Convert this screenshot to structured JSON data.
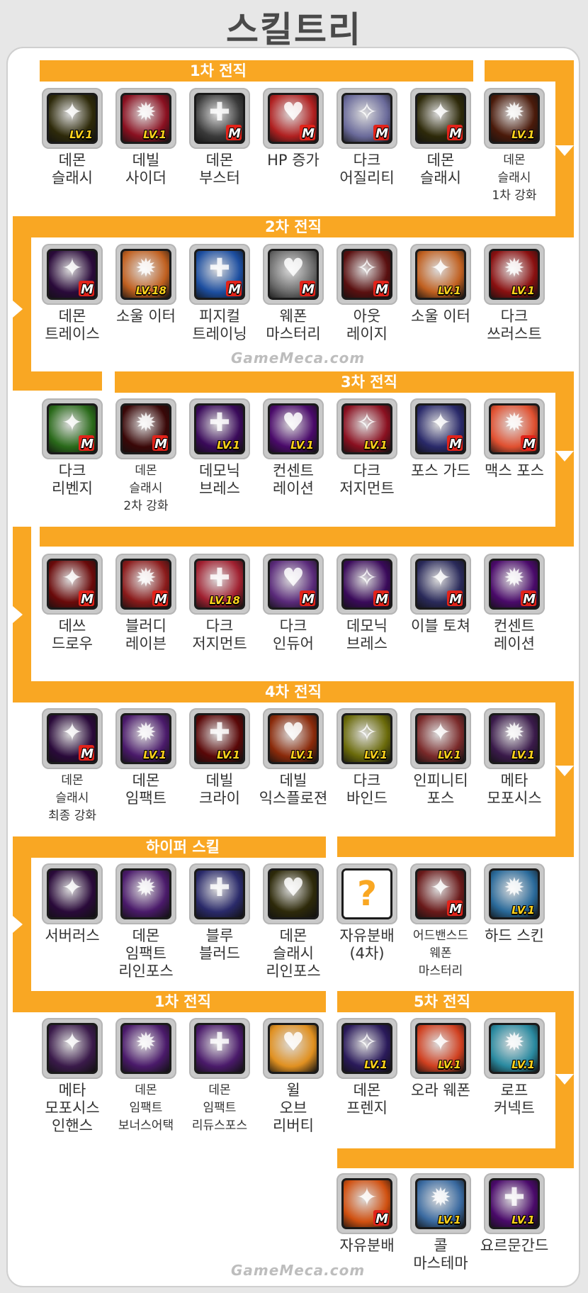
{
  "title": "스킬트리",
  "watermark": "GameMeca.com",
  "sections": {
    "s1": "1차 전직",
    "s2": "2차 전직",
    "s3": "3차 전직",
    "s4": "4차 전직",
    "hyper": "하이퍼 스킬",
    "s1b": "1차 전직",
    "s5": "5차 전직"
  },
  "skills": [
    {
      "name": "데몬\n슬래시",
      "badge": "LV.1",
      "color": "#2e2a0a"
    },
    {
      "name": "데빌\n사이더",
      "badge": "LV.1",
      "color": "#8a1020"
    },
    {
      "name": "데몬\n부스터",
      "badge": "M",
      "color": "#3a3a3a"
    },
    {
      "name": "HP 증가",
      "badge": "M",
      "color": "#b02020"
    },
    {
      "name": "다크\n어질리티",
      "badge": "M",
      "color": "#6a6a9a"
    },
    {
      "name": "데몬\n슬래시",
      "badge": "M",
      "color": "#2e2a0a"
    },
    {
      "name": "데몬\n슬래시\n1차 강화",
      "badge": "LV.1",
      "color": "#4a1a0a"
    },
    {
      "name": "데몬\n트레이스",
      "badge": "M",
      "color": "#2a0a3a"
    },
    {
      "name": "소울 이터",
      "badge": "LV.18",
      "color": "#c06020"
    },
    {
      "name": "피지컬\n트레이닝",
      "badge": "M",
      "color": "#1c4ea0"
    },
    {
      "name": "웨폰\n마스터리",
      "badge": "M",
      "color": "#6a6a6a"
    },
    {
      "name": "아웃\n레이지",
      "badge": "M",
      "color": "#5a1010"
    },
    {
      "name": "소울 이터",
      "badge": "LV.1",
      "color": "#c06020"
    },
    {
      "name": "다크\n쓰러스트",
      "badge": "LV.1",
      "color": "#8a1010"
    },
    {
      "name": "다크\n리벤지",
      "badge": "M",
      "color": "#2a6a1a"
    },
    {
      "name": "데몬\n슬래시\n2차 강화",
      "badge": "M",
      "color": "#3a0808"
    },
    {
      "name": "데모닉\n브레스",
      "badge": "LV.1",
      "color": "#3a0a5a"
    },
    {
      "name": "컨센트\n레이션",
      "badge": "LV.1",
      "color": "#4a0a6a"
    },
    {
      "name": "다크\n저지먼트",
      "badge": "LV.1",
      "color": "#8a1020"
    },
    {
      "name": "포스 가드",
      "badge": "M",
      "color": "#2a2a6a"
    },
    {
      "name": "맥스 포스",
      "badge": "M",
      "color": "#e05030"
    },
    {
      "name": "데쓰\n드로우",
      "badge": "M",
      "color": "#6a0a0a"
    },
    {
      "name": "블러디\n레이븐",
      "badge": "M",
      "color": "#8a1a1a"
    },
    {
      "name": "다크\n저지먼트",
      "badge": "LV.18",
      "color": "#a02030"
    },
    {
      "name": "다크\n인듀어",
      "badge": "M",
      "color": "#5a2a7a"
    },
    {
      "name": "데모닉\n브레스",
      "badge": "M",
      "color": "#3a0a5a"
    },
    {
      "name": "이블 토쳐",
      "badge": "M",
      "color": "#2a2a5a"
    },
    {
      "name": "컨센트\n레이션",
      "badge": "M",
      "color": "#4a0a6a"
    },
    {
      "name": "데몬\n슬래시\n최종 강화",
      "badge": "M",
      "color": "#2a0a3a"
    },
    {
      "name": "데몬\n임팩트",
      "badge": "LV.1",
      "color": "#4a1a6a"
    },
    {
      "name": "데빌\n크라이",
      "badge": "LV.1",
      "color": "#5a0808"
    },
    {
      "name": "데빌\n익스플로젼",
      "badge": "LV.1",
      "color": "#8a2a0a"
    },
    {
      "name": "다크\n바인드",
      "badge": "LV.1",
      "color": "#6a6a0a"
    },
    {
      "name": "인피니티\n포스",
      "badge": "LV.1",
      "color": "#7a2a2a"
    },
    {
      "name": "메타\n모포시스",
      "badge": "LV.1",
      "color": "#3a1a4a"
    },
    {
      "name": "서버러스",
      "badge": "",
      "color": "#2a0a3a"
    },
    {
      "name": "데몬\n임팩트\n리인포스",
      "badge": "",
      "color": "#4a1a6a"
    },
    {
      "name": "블루\n블러드",
      "badge": "",
      "color": "#2a2a6a"
    },
    {
      "name": "데몬\n슬래시\n리인포스",
      "badge": "",
      "color": "#2e2a0a"
    },
    {
      "name": "자유분배\n(4차)",
      "badge": "",
      "color": "#ffffff"
    },
    {
      "name": "어드밴스드\n웨폰\n마스터리",
      "badge": "M",
      "color": "#6a1a1a"
    },
    {
      "name": "하드 스킨",
      "badge": "LV.1",
      "color": "#2a6a9a"
    },
    {
      "name": "메타\n모포시스\n인핸스",
      "badge": "",
      "color": "#3a1a4a"
    },
    {
      "name": "데몬\n임팩트\n보너스어택",
      "badge": "",
      "color": "#4a1a6a"
    },
    {
      "name": "데몬\n임팩트\n리듀스포스",
      "badge": "",
      "color": "#4a1a6a"
    },
    {
      "name": "윌\n오브\n리버티",
      "badge": "",
      "color": "#e09020"
    },
    {
      "name": "데몬\n프렌지",
      "badge": "LV.1",
      "color": "#2a1a5a"
    },
    {
      "name": "오라 웨폰",
      "badge": "LV.1",
      "color": "#d04020"
    },
    {
      "name": "로프\n커넥트",
      "badge": "LV.1",
      "color": "#2a8aa0"
    },
    {
      "name": "자유분배",
      "badge": "M",
      "color": "#d05010"
    },
    {
      "name": "콜\n마스테마",
      "badge": "LV.1",
      "color": "#3a6aa0"
    },
    {
      "name": "요르문간드",
      "badge": "LV.1",
      "color": "#4a0a6a"
    }
  ]
}
